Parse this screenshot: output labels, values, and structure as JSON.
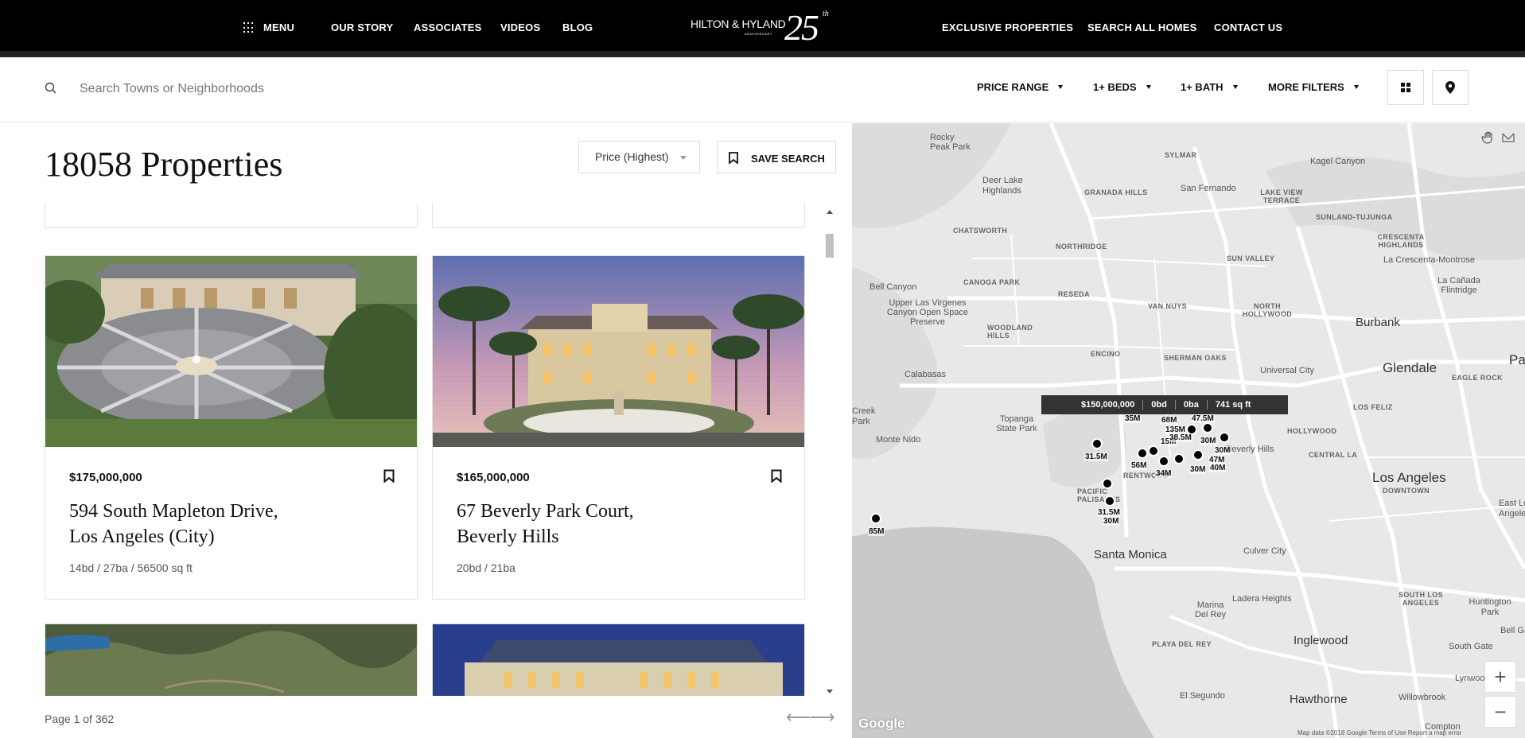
{
  "nav": {
    "menu_label": "MENU",
    "left_links": [
      "OUR STORY",
      "ASSOCIATES",
      "VIDEOS",
      "BLOG"
    ],
    "right_links": [
      "EXCLUSIVE PROPERTIES",
      "SEARCH ALL HOMES",
      "CONTACT US"
    ],
    "logo_text": "HILTON & HYLAND",
    "logo_sub": "ANNIVERSARY",
    "logo_number": "25",
    "logo_suffix": "th"
  },
  "filters": {
    "search_placeholder": "Search Towns or Neighborhoods",
    "price_range": "PRICE RANGE",
    "beds": "1+ BEDS",
    "baths": "1+ BATH",
    "more": "MORE FILTERS"
  },
  "listing": {
    "count_title": "18058 Properties",
    "sort_value": "Price (Highest)",
    "save_search": "SAVE SEARCH",
    "page_info": "Page 1 of 362",
    "cards": [
      {
        "price": "$175,000,000",
        "address_line1": "594 South Mapleton Drive,",
        "address_line2": "Los Angeles (City)",
        "specs": "14bd / 27ba / 56500 sq ft"
      },
      {
        "price": "$165,000,000",
        "address_line1": "67 Beverly Park Court,",
        "address_line2": "Beverly Hills",
        "specs": "20bd / 21ba"
      }
    ]
  },
  "map": {
    "tooltip": {
      "price": "$150,000,000",
      "beds": "0bd",
      "baths": "0ba",
      "sqft": "741 sq ft"
    },
    "labels": {
      "rocky_peak": "Rocky Peak Park",
      "sylmar": "SYLMAR",
      "kagel": "Kagel Canyon",
      "deer_lake": "Deer Lake Highlands",
      "granada": "GRANADA HILLS",
      "san_fernando": "San Fernando",
      "lake_view": "LAKE VIEW TERRACE",
      "sunland": "SUNLAND-TUJUNGA",
      "chatsworth": "CHATSWORTH",
      "crescenta": "CRESCENTA HIGHLANDS",
      "northridge": "NORTHRIDGE",
      "sun_valley": "SUN VALLEY",
      "la_crescenta": "La Crescenta-Montrose",
      "canoga": "CANOGA PARK",
      "bell_canyon": "Bell Canyon",
      "la_canada": "La Cañada Flintridge",
      "reseda": "RESEDA",
      "van_nuys": "VAN NUYS",
      "north_hollywood": "NORTH HOLLYWOOD",
      "upper_las": "Upper Las Virgenes Canyon Open Space Preserve",
      "burbank": "Burbank",
      "woodland": "WOODLAND HILLS",
      "encino": "ENCINO",
      "sherman": "SHERMAN OAKS",
      "universal": "Universal City",
      "glendale": "Glendale",
      "pasa": "Pasa",
      "calabasas": "Calabasas",
      "eagle_rock": "EAGLE ROCK",
      "los_feliz": "LOS FELIZ",
      "creek_park": "Creek Park",
      "topanga": "Topanga State Park",
      "hollywood": "HOLLYWOOD",
      "monte_nido": "Monte Nido",
      "beverly_hills": "Beverly Hills",
      "central_la": "CENTRAL LA",
      "los_angeles": "Los Angeles",
      "downtown": "DOWNTOWN",
      "brentwood": "RENTWOOD",
      "pacific": "PACIFIC PALISADES",
      "east_la": "East Los Angeles",
      "santa_monica": "Santa Monica",
      "culver": "Culver City",
      "south_la": "SOUTH LOS ANGELES",
      "ladera": "Ladera Heights",
      "huntington": "Huntington Park",
      "bell_gardens": "Bell Gar",
      "marina": "Marina Del Rey",
      "playa": "PLAYA DEL REY",
      "inglewood": "Inglewood",
      "south_gate": "South Gate",
      "lynwood": "Lynwood",
      "el_segundo": "El Segundo",
      "hawthorne": "Hawthorne",
      "willowbrook": "Willowbrook",
      "compton": "Compton"
    },
    "pins": [
      "35M",
      "68M",
      "135M",
      "47.5M",
      "15M",
      "38.5M",
      "30M",
      "31.5M",
      "30M",
      "56M",
      "34M",
      "30M",
      "40M",
      "47M",
      "31.5M",
      "30M",
      "85M"
    ],
    "zoom_in": "+",
    "zoom_out": "−",
    "google": "Google",
    "attribution": "Map data ©2018 Google   Terms of Use   Report a map error"
  }
}
